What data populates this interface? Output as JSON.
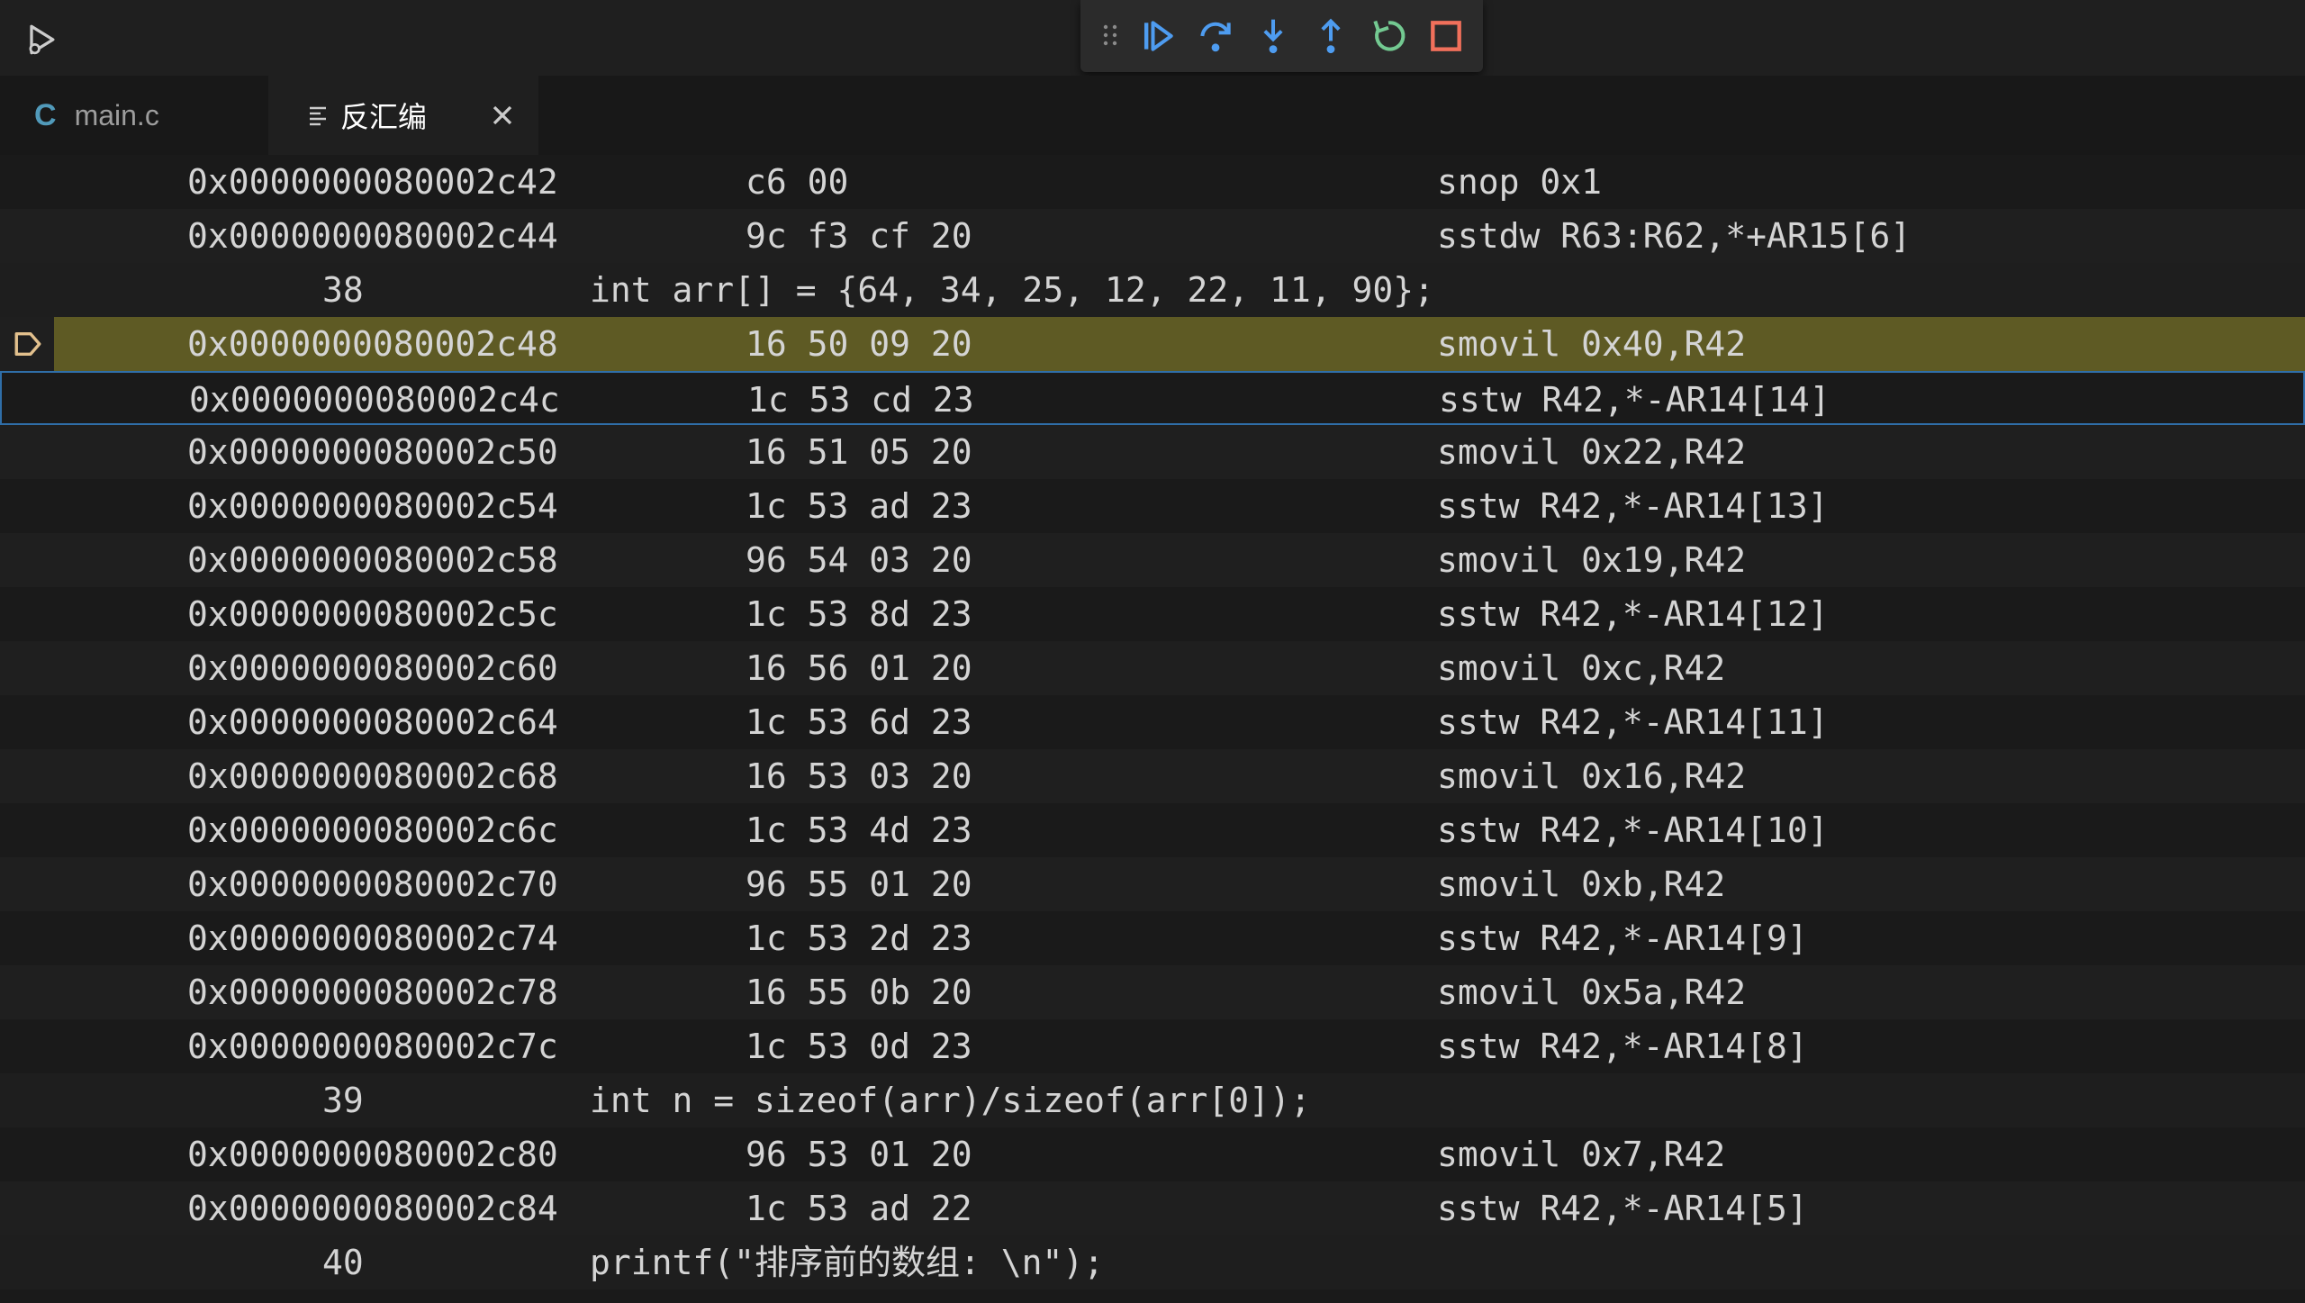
{
  "tabs": [
    {
      "label": "main.c",
      "icon": "c-file-icon"
    },
    {
      "label": "反汇编",
      "icon": "lines-icon"
    }
  ],
  "debug_toolbar": {
    "buttons": [
      "continue-icon",
      "step-over-icon",
      "step-into-icon",
      "step-out-icon",
      "restart-icon",
      "stop-icon"
    ]
  },
  "colors": {
    "current_line": "#5e5a24",
    "focused_border": "#2f6ea8",
    "continue": "#4e9cf0",
    "restart": "#73c991",
    "stop": "#f1705b",
    "ip_marker": "#e2c08d"
  },
  "rows": [
    {
      "type": "asm",
      "address": "0x0000000080002c42",
      "bytes": "c6 00",
      "instruction": "snop 0x1"
    },
    {
      "type": "asm",
      "address": "0x0000000080002c44",
      "bytes": "9c f3 cf 20",
      "instruction": "sstdw R63:R62,*+AR15[6]"
    },
    {
      "type": "source",
      "line": "38",
      "code": "int arr[] = {64, 34, 25, 12, 22, 11, 90};"
    },
    {
      "type": "asm",
      "address": "0x0000000080002c48",
      "bytes": "16 50 09 20",
      "instruction": "smovil 0x40,R42",
      "current": true
    },
    {
      "type": "asm",
      "address": "0x0000000080002c4c",
      "bytes": "1c 53 cd 23",
      "instruction": "sstw R42,*-AR14[14]",
      "focused": true
    },
    {
      "type": "asm",
      "address": "0x0000000080002c50",
      "bytes": "16 51 05 20",
      "instruction": "smovil 0x22,R42"
    },
    {
      "type": "asm",
      "address": "0x0000000080002c54",
      "bytes": "1c 53 ad 23",
      "instruction": "sstw R42,*-AR14[13]"
    },
    {
      "type": "asm",
      "address": "0x0000000080002c58",
      "bytes": "96 54 03 20",
      "instruction": "smovil 0x19,R42"
    },
    {
      "type": "asm",
      "address": "0x0000000080002c5c",
      "bytes": "1c 53 8d 23",
      "instruction": "sstw R42,*-AR14[12]"
    },
    {
      "type": "asm",
      "address": "0x0000000080002c60",
      "bytes": "16 56 01 20",
      "instruction": "smovil 0xc,R42"
    },
    {
      "type": "asm",
      "address": "0x0000000080002c64",
      "bytes": "1c 53 6d 23",
      "instruction": "sstw R42,*-AR14[11]"
    },
    {
      "type": "asm",
      "address": "0x0000000080002c68",
      "bytes": "16 53 03 20",
      "instruction": "smovil 0x16,R42"
    },
    {
      "type": "asm",
      "address": "0x0000000080002c6c",
      "bytes": "1c 53 4d 23",
      "instruction": "sstw R42,*-AR14[10]"
    },
    {
      "type": "asm",
      "address": "0x0000000080002c70",
      "bytes": "96 55 01 20",
      "instruction": "smovil 0xb,R42"
    },
    {
      "type": "asm",
      "address": "0x0000000080002c74",
      "bytes": "1c 53 2d 23",
      "instruction": "sstw R42,*-AR14[9]"
    },
    {
      "type": "asm",
      "address": "0x0000000080002c78",
      "bytes": "16 55 0b 20",
      "instruction": "smovil 0x5a,R42"
    },
    {
      "type": "asm",
      "address": "0x0000000080002c7c",
      "bytes": "1c 53 0d 23",
      "instruction": "sstw R42,*-AR14[8]"
    },
    {
      "type": "source",
      "line": "39",
      "code": "int n = sizeof(arr)/sizeof(arr[0]);"
    },
    {
      "type": "asm",
      "address": "0x0000000080002c80",
      "bytes": "96 53 01 20",
      "instruction": "smovil 0x7,R42"
    },
    {
      "type": "asm",
      "address": "0x0000000080002c84",
      "bytes": "1c 53 ad 22",
      "instruction": "sstw R42,*-AR14[5]"
    },
    {
      "type": "source",
      "line": "40",
      "code": "printf(\"排序前的数组: \\n\");"
    }
  ]
}
